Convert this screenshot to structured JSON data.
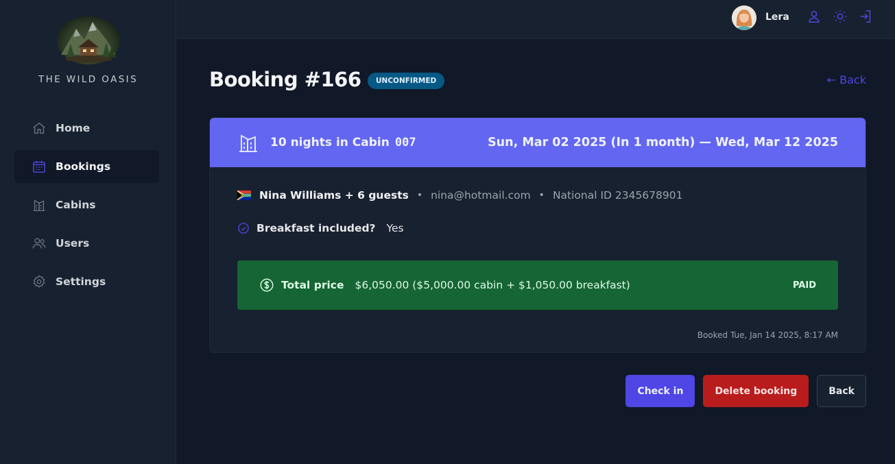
{
  "brand": {
    "name": "THE WILD OASIS"
  },
  "sidebar": {
    "items": [
      {
        "label": "Home",
        "icon": "home-icon"
      },
      {
        "label": "Bookings",
        "icon": "calendar-icon",
        "active": true
      },
      {
        "label": "Cabins",
        "icon": "cabins-icon"
      },
      {
        "label": "Users",
        "icon": "users-icon"
      },
      {
        "label": "Settings",
        "icon": "gear-icon"
      }
    ]
  },
  "header": {
    "user_name": "Lera",
    "icons": [
      "user-icon",
      "sun-icon",
      "logout-icon"
    ]
  },
  "booking": {
    "title": "Booking #166",
    "status": "unconfirmed",
    "back_link": "← Back",
    "nights_text": "10 nights in Cabin",
    "cabin_code": "007",
    "dates": "Sun, Mar 02 2025 (In 1 month) — Wed, Mar 12 2025",
    "guest_name": "Nina Williams + 6 guests",
    "guest_email": "nina@hotmail.com",
    "national_id": "National ID 2345678901",
    "breakfast_label": "Breakfast included?",
    "breakfast_value": "Yes",
    "price_label": "Total price",
    "price_value": "$6,050.00 ($5,000.00 cabin + $1,050.00 breakfast)",
    "paid_status": "Paid",
    "booked_at": "Booked Tue, Jan 14 2025, 8:17 AM"
  },
  "actions": {
    "check_in": "Check in",
    "delete": "Delete booking",
    "back": "Back"
  },
  "colors": {
    "accent": "#4f46e5",
    "header_band": "#6366f1",
    "paid_green": "#166534",
    "danger": "#b91c1c",
    "status_tag": "#075985"
  }
}
